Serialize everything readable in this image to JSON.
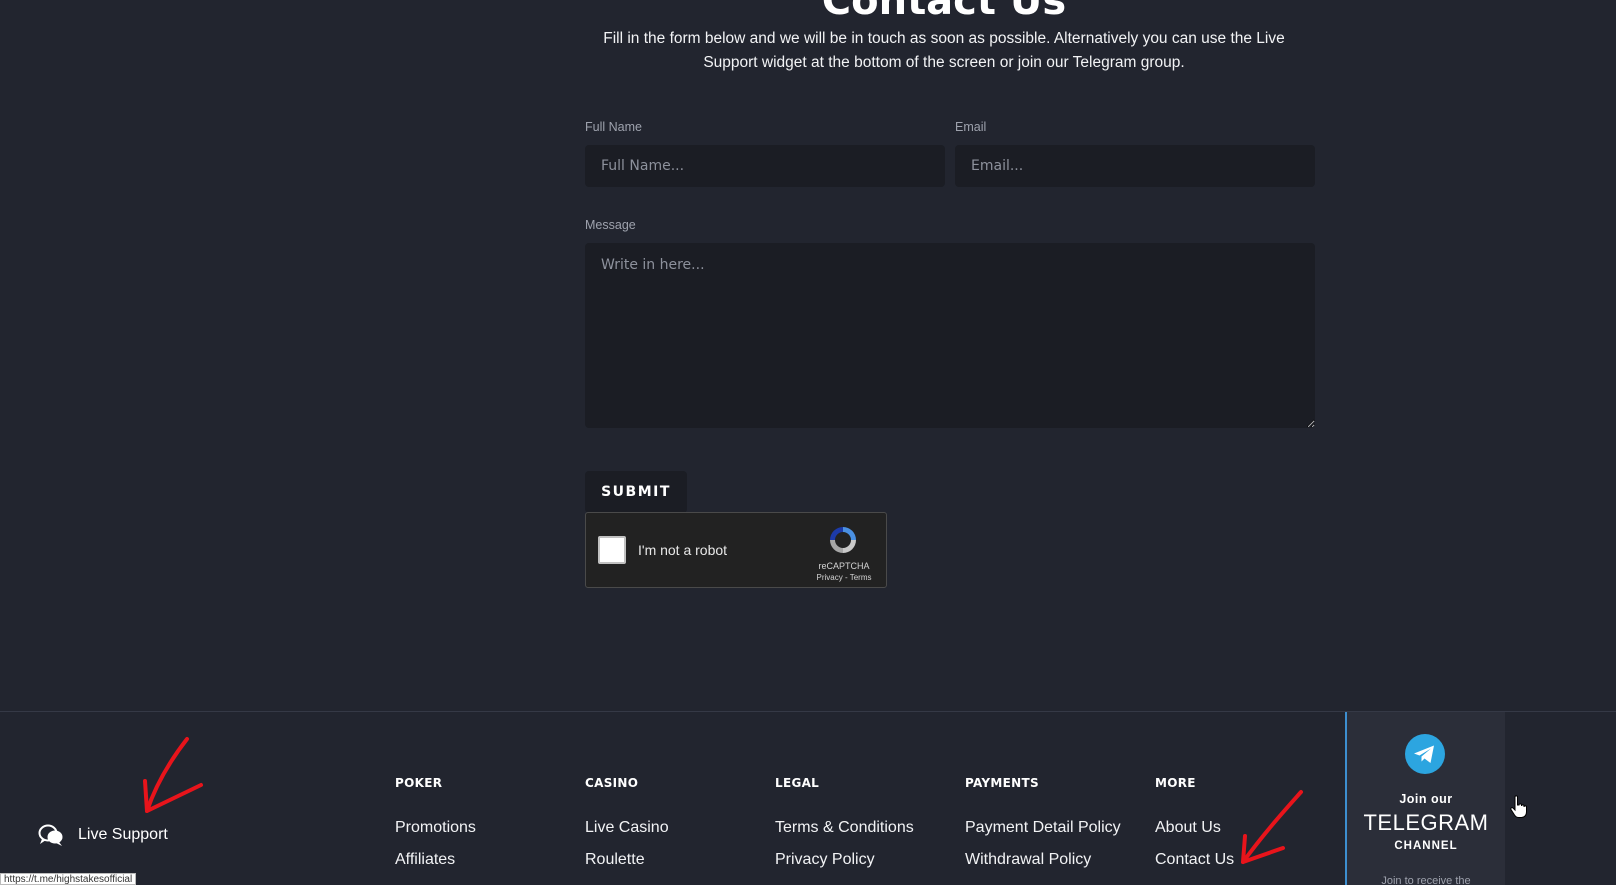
{
  "page": {
    "title": "Contact Us",
    "intro": "Fill in the form below and we will be in touch as soon as possible. Alternatively you can use the Live Support widget at the bottom of the screen or join our Telegram group."
  },
  "form": {
    "full_name": {
      "label": "Full Name",
      "placeholder": "Full Name...",
      "value": ""
    },
    "email": {
      "label": "Email",
      "placeholder": "Email...",
      "value": ""
    },
    "message": {
      "label": "Message",
      "placeholder": "Write in here...",
      "value": ""
    },
    "submit_label": "SUBMIT"
  },
  "recaptcha": {
    "label": "I'm not a robot",
    "brand": "reCAPTCHA",
    "links": "Privacy - Terms",
    "checked": false
  },
  "live_support": {
    "label": "Live Support",
    "icon": "chat-bubbles-icon"
  },
  "footer": {
    "columns": [
      {
        "title": "POKER",
        "links": [
          "Promotions",
          "Affiliates"
        ]
      },
      {
        "title": "CASINO",
        "links": [
          "Live Casino",
          "Roulette"
        ]
      },
      {
        "title": "LEGAL",
        "links": [
          "Terms & Conditions",
          "Privacy Policy"
        ]
      },
      {
        "title": "PAYMENTS",
        "links": [
          "Payment Detail Policy",
          "Withdrawal Policy"
        ]
      },
      {
        "title": "MORE",
        "links": [
          "About Us",
          "Contact Us"
        ]
      }
    ]
  },
  "telegram": {
    "join": "Join our",
    "big": "TELEGRAM",
    "channel": "CHANNEL",
    "sub": "Join to receive the",
    "icon": "telegram-icon",
    "accent": "#2ca5e0"
  },
  "status_url": "https://t.me/highstakesofficial",
  "colors": {
    "background": "#22252f",
    "input_bg": "#1b1d24",
    "annotation": "#e8141b"
  }
}
